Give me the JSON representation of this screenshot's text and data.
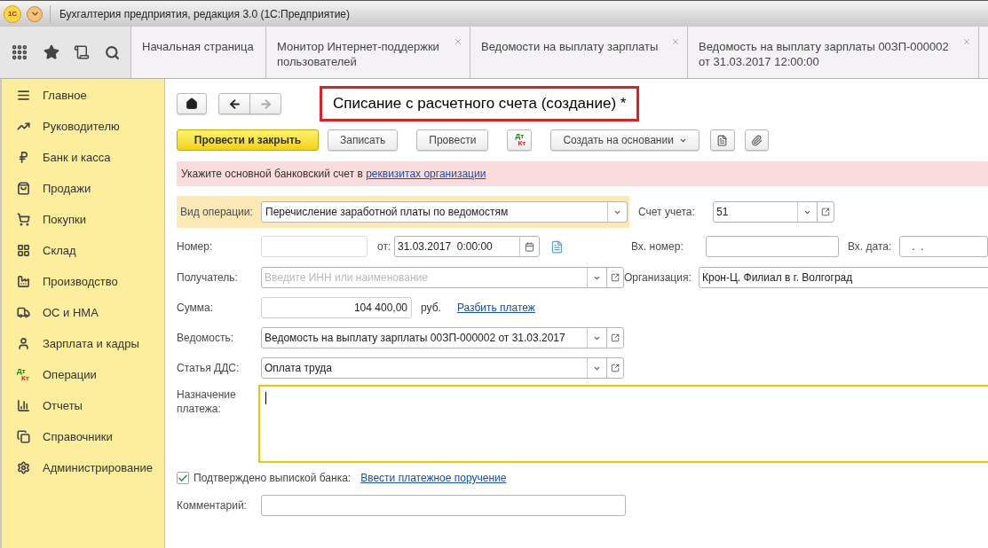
{
  "window": {
    "logo": "1С",
    "title": "Бухгалтерия предприятия, редакция 3.0  (1С:Предприятие)"
  },
  "tabs": [
    {
      "label": "Начальная страница",
      "closable": false
    },
    {
      "label": "Монитор Интернет-поддержки пользователей",
      "closable": true
    },
    {
      "label": "Ведомости на выплату зарплаты",
      "closable": true
    },
    {
      "label": "Ведомость на выплату зарплаты 00ЗП-000002 от 31.03.2017 12:00:00",
      "closable": true
    }
  ],
  "sidebar": {
    "items": [
      {
        "label": "Главное"
      },
      {
        "label": "Руководителю"
      },
      {
        "label": "Банк и касса"
      },
      {
        "label": "Продажи"
      },
      {
        "label": "Покупки"
      },
      {
        "label": "Склад"
      },
      {
        "label": "Производство"
      },
      {
        "label": "ОС и НМА"
      },
      {
        "label": "Зарплата и кадры"
      },
      {
        "label": "Операции",
        "icon_text": [
          "Дт",
          "Кт"
        ]
      },
      {
        "label": "Отчеты"
      },
      {
        "label": "Справочники"
      },
      {
        "label": "Администрирование"
      }
    ]
  },
  "form": {
    "title": "Списание с расчетного счета (создание) *",
    "buttons": [
      {
        "kind": "primary",
        "label": "Провести и закрыть"
      },
      {
        "kind": "normal",
        "label": "Записать"
      },
      {
        "kind": "normal",
        "label": "Провести"
      },
      {
        "kind": "dtkt",
        "icon_text": [
          "Дт",
          "Кт"
        ]
      },
      {
        "kind": "menu",
        "label": "Создать на основании"
      },
      {
        "kind": "report"
      },
      {
        "kind": "attach"
      }
    ],
    "warning": {
      "text": "Укажите основной банковский счет в",
      "link": "реквизитах организации"
    },
    "operation": {
      "label": "Вид операции:",
      "value": "Перечисление заработной платы по ведомостям"
    },
    "account": {
      "label": "Счет учета:",
      "value": "51"
    },
    "number": {
      "label": "Номер:",
      "disabled": true,
      "date_label": "от:",
      "date": "31.03.2017  0:00:00"
    },
    "incoming_number": {
      "label": "Вх. номер:"
    },
    "incoming_date": {
      "label": "Вх. дата:",
      "value": " .  ."
    },
    "recipient": {
      "label": "Получатель:",
      "placeholder": "Введите ИНН или наименование"
    },
    "organization": {
      "label": "Организация:",
      "value": "Крон-Ц. Филиал в г. Волгоград"
    },
    "amount": {
      "label": "Сумма:",
      "value": "104 400,00",
      "currency": "руб.",
      "link": "Разбить платеж"
    },
    "statement": {
      "label": "Ведомость:",
      "value": "Ведомость на выплату зарплаты 00ЗП-000002 от 31.03.2017"
    },
    "cash_flow_item": {
      "label": "Статья ДДС:",
      "value": "Оплата труда"
    },
    "purpose": {
      "label": "Назначение платежа:",
      "focused": true
    },
    "confirmed": {
      "label": "Подтверждено выпиской банка:",
      "checked": true,
      "link": "Ввести платежное поручение"
    },
    "comment": {
      "label": "Комментарий:"
    }
  }
}
